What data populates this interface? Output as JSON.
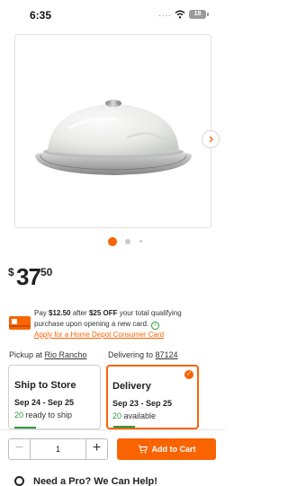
{
  "status_bar": {
    "time": "6:35",
    "signal": "....",
    "battery": "18"
  },
  "gallery": {
    "image": "flush-mount-ceiling-light",
    "current_index": 1,
    "total_dots": 3
  },
  "price": {
    "currency": "$",
    "dollars": "37",
    "cents": "50"
  },
  "offer": {
    "line1_prefix": "Pay ",
    "line1_amount": "$12.50",
    "line1_middle": " after ",
    "line1_discount": "$25 OFF",
    "line1_suffix": " your total qualifying",
    "line2": "purchase upon opening a new card.",
    "link": "Apply for a Home Depot Consumer Card"
  },
  "fulfillment": {
    "pickup_prefix": "Pickup at ",
    "pickup_store": "Rio Rancho",
    "delivery_prefix": "Delivering to ",
    "delivery_zip": "87124",
    "ship": {
      "title": "Ship to Store",
      "dates": "Sep 24 - Sep 25",
      "count": "20",
      "status": " ready to ship"
    },
    "delivery": {
      "title": "Delivery",
      "dates": "Sep 23 - Sep 25",
      "count": "20",
      "status": " available",
      "selected": true
    }
  },
  "cart": {
    "quantity": "1",
    "minus": "−",
    "plus": "+",
    "add_label": "Add to Cart"
  },
  "promo": {
    "text": "Need a Pro? We Can Help!"
  },
  "colors": {
    "brand_orange": "#f96302",
    "stock_green": "#2d9a3a"
  }
}
